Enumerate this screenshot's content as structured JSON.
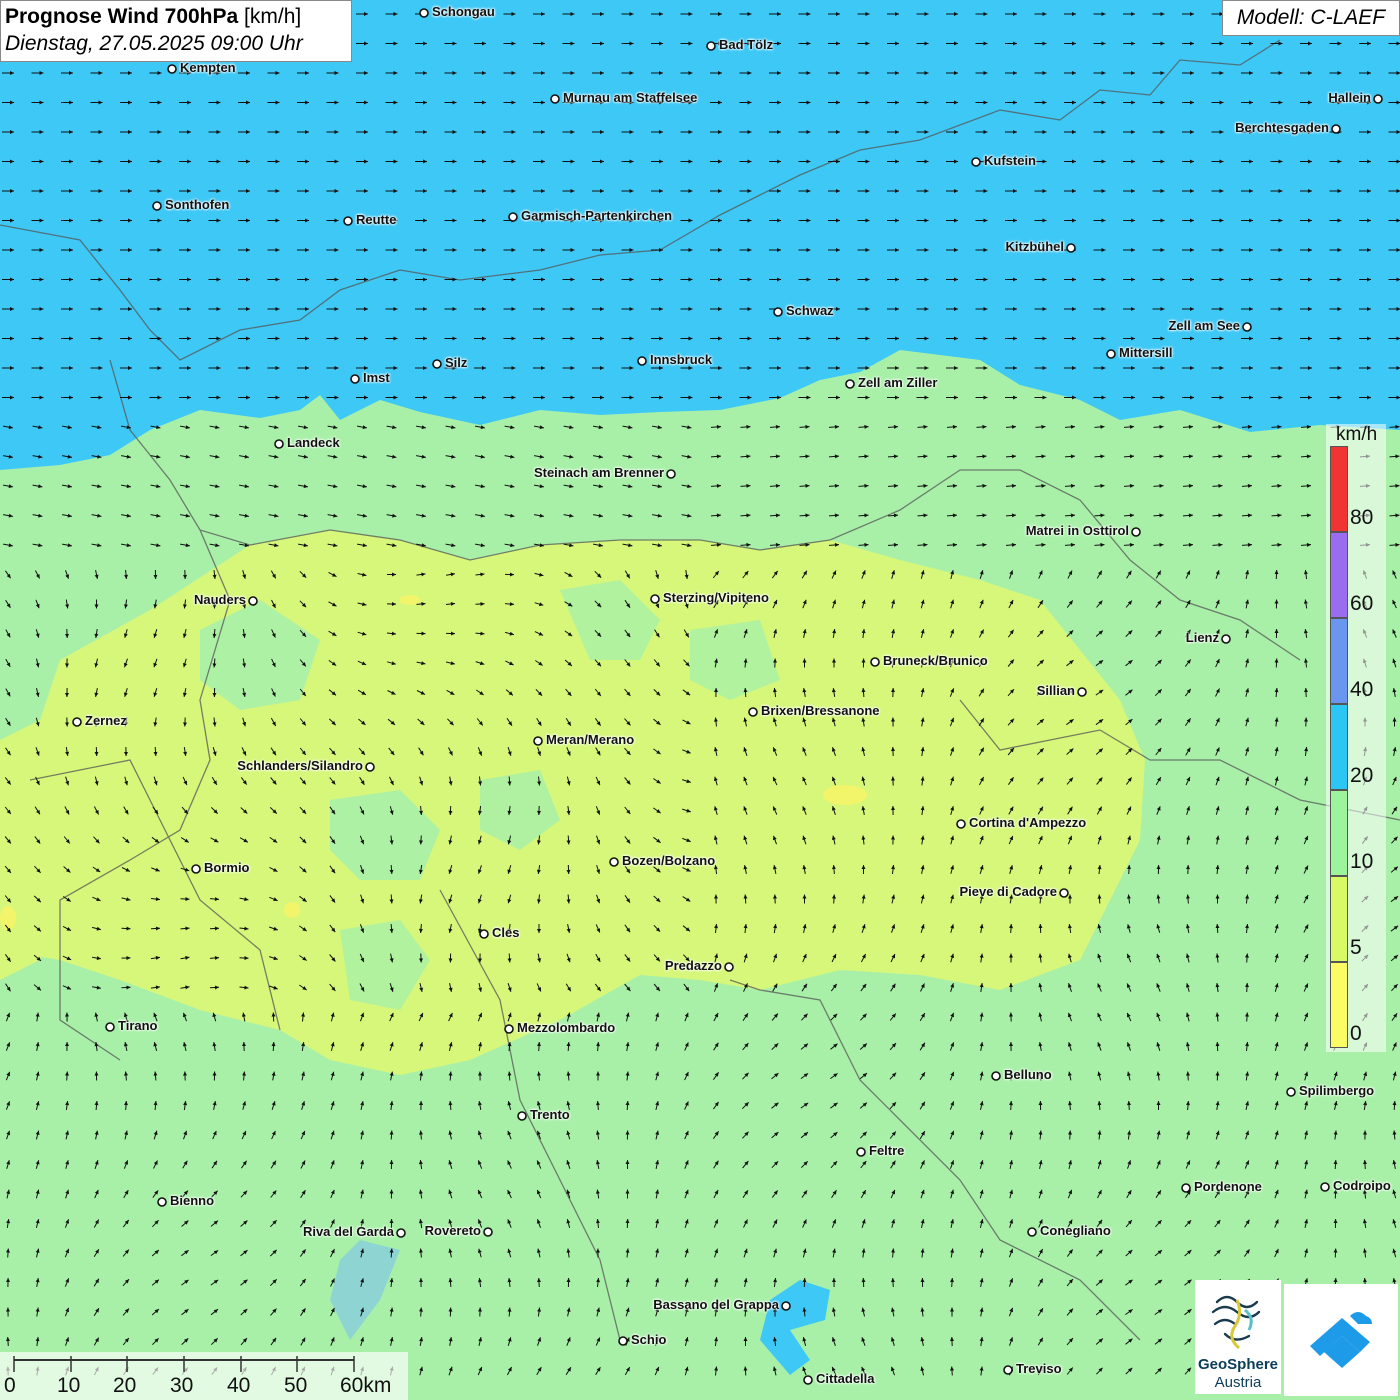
{
  "header": {
    "title": "Prognose Wind 700hPa",
    "unit": "[km/h]",
    "datetime": "Dienstag, 27.05.2025 09:00 Uhr",
    "model": "Modell: C-LAEF"
  },
  "legend": {
    "unit": "km/h",
    "levels": [
      {
        "label": "0",
        "color": "#fbfb64"
      },
      {
        "label": "5",
        "color": "#d8fa64"
      },
      {
        "label": "10",
        "color": "#9cf59c"
      },
      {
        "label": "20",
        "color": "#2cc6f4"
      },
      {
        "label": "40",
        "color": "#6b96f0"
      },
      {
        "label": "60",
        "color": "#9a6cf0"
      },
      {
        "label": "80",
        "color": "#f03434"
      }
    ]
  },
  "scale": {
    "labels": [
      "0",
      "10",
      "20",
      "30",
      "40",
      "50",
      "60km"
    ]
  },
  "logos": {
    "geosphere_line1": "GeoSphere",
    "geosphere_line2": "Austria"
  },
  "colors": {
    "strong_wind": "#3ec8f5",
    "moderate_wind": "#a8f0a8",
    "light_wind": "#d6f77a",
    "calm": "#f2f56a"
  },
  "cities": [
    {
      "name": "Schongau"
    },
    {
      "name": "Bad Tölz"
    },
    {
      "name": "Kempten"
    },
    {
      "name": "Murnau am Staffelsee"
    },
    {
      "name": "Hallein"
    },
    {
      "name": "Berchtesgaden"
    },
    {
      "name": "Kufstein"
    },
    {
      "name": "Sonthofen"
    },
    {
      "name": "Reutte"
    },
    {
      "name": "Garmisch-Partenkirchen"
    },
    {
      "name": "Kitzbühel"
    },
    {
      "name": "Schwaz"
    },
    {
      "name": "Zell am See"
    },
    {
      "name": "Mittersill"
    },
    {
      "name": "Imst"
    },
    {
      "name": "Silz"
    },
    {
      "name": "Innsbruck"
    },
    {
      "name": "Zell am Ziller"
    },
    {
      "name": "Landeck"
    },
    {
      "name": "Steinach am Brenner"
    },
    {
      "name": "Matrei in Osttirol"
    },
    {
      "name": "Nauders"
    },
    {
      "name": "Sterzing/Vipiteno"
    },
    {
      "name": "Lienz"
    },
    {
      "name": "Bruneck/Brunico"
    },
    {
      "name": "Sillian"
    },
    {
      "name": "Zernez"
    },
    {
      "name": "Brixen/Bressanone"
    },
    {
      "name": "Meran/Merano"
    },
    {
      "name": "Schlanders/Silandro"
    },
    {
      "name": "Cortina d'Ampezzo"
    },
    {
      "name": "Bozen/Bolzano"
    },
    {
      "name": "Bormio"
    },
    {
      "name": "Pieve di Cadore"
    },
    {
      "name": "Cles"
    },
    {
      "name": "Predazzo"
    },
    {
      "name": "Tirano"
    },
    {
      "name": "Mezzolombardo"
    },
    {
      "name": "Belluno"
    },
    {
      "name": "Spilimbergo"
    },
    {
      "name": "Trento"
    },
    {
      "name": "Feltre"
    },
    {
      "name": "Pordenone"
    },
    {
      "name": "Codroipo"
    },
    {
      "name": "Bienno"
    },
    {
      "name": "Riva del Garda"
    },
    {
      "name": "Rovereto"
    },
    {
      "name": "Conegliano"
    },
    {
      "name": "Bassano del Grappa"
    },
    {
      "name": "Schio"
    },
    {
      "name": "Treviso"
    },
    {
      "name": "Cittadella"
    }
  ]
}
